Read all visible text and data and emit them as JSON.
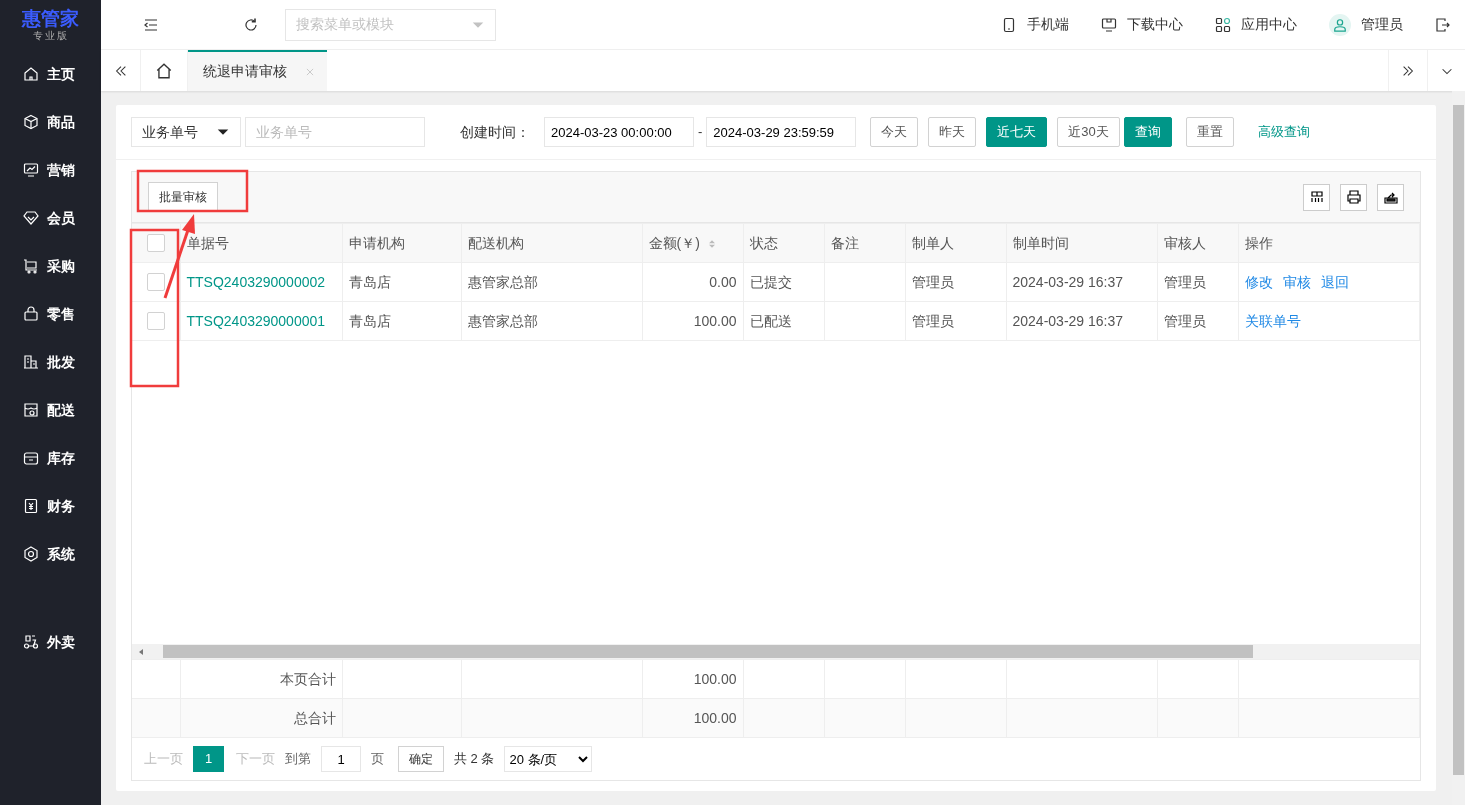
{
  "brand": {
    "name": "惠管家",
    "edition": "专业版"
  },
  "sidebar": {
    "items": [
      {
        "label": "主页"
      },
      {
        "label": "商品"
      },
      {
        "label": "营销"
      },
      {
        "label": "会员"
      },
      {
        "label": "采购"
      },
      {
        "label": "零售"
      },
      {
        "label": "批发"
      },
      {
        "label": "配送"
      },
      {
        "label": "库存"
      },
      {
        "label": "财务"
      },
      {
        "label": "系统"
      }
    ],
    "extra_items": [
      {
        "label": "外卖"
      }
    ]
  },
  "topbar": {
    "search": {
      "placeholder": "搜索菜单或模块"
    },
    "links": [
      {
        "label": "手机端"
      },
      {
        "label": "下载中心"
      },
      {
        "label": "应用中心"
      }
    ],
    "user": "管理员"
  },
  "tabs": [
    {
      "label": "统退申请审核",
      "selected": true
    }
  ],
  "filter": {
    "field_select": "业务单号",
    "field": {
      "placeholder": "业务单号"
    },
    "date_label": "创建时间：",
    "start": "2024-03-23 00:00:00",
    "separator": "-",
    "end": "2024-03-29 23:59:59",
    "quick": [
      {
        "label": "今天",
        "selected": false
      },
      {
        "label": "昨天",
        "selected": false
      },
      {
        "label": "近七天",
        "selected": true
      },
      {
        "label": "近30天",
        "selected": false
      }
    ],
    "query": "查询",
    "reset": "重置",
    "advanced": "高级查询"
  },
  "toolbar": {
    "batch": "批量审核"
  },
  "table": {
    "header_checked": false,
    "columns": [
      {
        "label": "单据号",
        "sortable": false
      },
      {
        "label": "申请机构",
        "sortable": false
      },
      {
        "label": "配送机构",
        "sortable": false
      },
      {
        "label": "金额(￥)",
        "sortable": true
      },
      {
        "label": "状态",
        "sortable": false
      },
      {
        "label": "备注",
        "sortable": false
      },
      {
        "label": "制单人",
        "sortable": false
      },
      {
        "label": "制单时间",
        "sortable": false
      },
      {
        "label": "审核人",
        "sortable": false
      },
      {
        "label": "操作",
        "sortable": false
      }
    ],
    "rows": [
      {
        "checked": false,
        "cells": [
          "TTSQ2403290000002",
          "青岛店",
          "惠管家总部",
          "0.00",
          "已提交",
          "",
          "管理员",
          "2024-03-29 16:37",
          "管理员"
        ],
        "actions": [
          "修改",
          "审核",
          "退回"
        ]
      },
      {
        "checked": false,
        "cells": [
          "TTSQ2403290000001",
          "青岛店",
          "惠管家总部",
          "100.00",
          "已配送",
          "",
          "管理员",
          "2024-03-29 16:37",
          "管理员"
        ],
        "actions": [
          "关联单号"
        ]
      }
    ],
    "summary": [
      {
        "label": "本页合计",
        "amount": "100.00"
      },
      {
        "label": "总合计",
        "amount": "100.00"
      }
    ]
  },
  "pagination": {
    "prev": "上一页",
    "pages": [
      {
        "label": "1",
        "selected": true
      }
    ],
    "next": "下一页",
    "goto": "到第",
    "page_value": "1",
    "unit": "页",
    "confirm": "确定",
    "total": "共 2 条",
    "page_size": "20 条/页"
  },
  "annotations": [
    {
      "kind": "box"
    },
    {
      "kind": "box"
    },
    {
      "kind": "arrow"
    }
  ]
}
